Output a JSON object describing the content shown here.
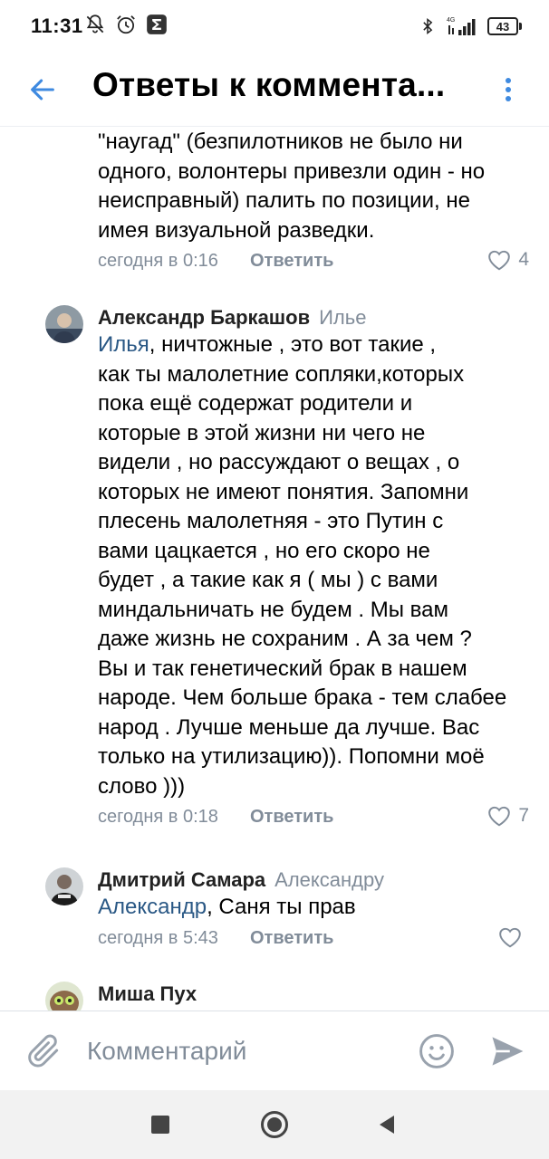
{
  "status_bar": {
    "time": "11:31",
    "icons_left": [
      "no-notifications-icon",
      "alarm-icon",
      "sigma-app-icon"
    ],
    "icons_right": [
      "bluetooth-icon",
      "signal-4g-icon"
    ],
    "network": "4G",
    "battery": "43"
  },
  "header": {
    "title": "Ответы к коммента...",
    "back_icon": "arrow-left-icon",
    "more_icon": "more-vertical-icon"
  },
  "colors": {
    "accent": "#3f8ae0",
    "link": "#2a5885",
    "secondary": "#818c99"
  },
  "comments": [
    {
      "author": "",
      "reply_to": "",
      "mention": "",
      "text_lines": [
        "\"наугад\" (безпилотников не было ни",
        "одного, волонтеры привезли один - но",
        "неисправный) палить по позиции, не",
        "имея визуальной разведки."
      ],
      "date": "сегодня в 0:16",
      "reply_label": "Ответить",
      "likes": "4"
    },
    {
      "author": "Александр Баркашов",
      "reply_to": "Илье",
      "mention": "Илья",
      "text_first": ", ничтожные , это вот такие ,",
      "text_lines": [
        "как ты малолетние сопляки,которых",
        "пока ещё содержат родители и",
        "которые в этой жизни ни чего не",
        "видели , но рассуждают о вещах , о",
        "которых не имеют понятия. Запомни",
        "плесень малолетняя - это Путин с",
        "вами цацкается , но его скоро не",
        "будет , а такие как я ( мы ) с вами",
        "миндальничать не будем . Мы вам",
        "даже жизнь не сохраним . А за чем ?",
        "Вы и так генетический брак в нашем",
        "народе. Чем больше брака - тем слабее",
        "народ . Лучше меньше да лучше. Вас",
        "только на утилизацию)). Попомни моё",
        "слово )))"
      ],
      "date": "сегодня в 0:18",
      "reply_label": "Ответить",
      "likes": "7"
    },
    {
      "author": "Дмитрий Самара",
      "reply_to": "Александру",
      "mention": "Александр",
      "text_first": ", Саня ты прав",
      "date": "сегодня в 5:43",
      "reply_label": "Ответить",
      "likes": ""
    },
    {
      "author": "Миша Пух"
    }
  ],
  "composer": {
    "placeholder": "Комментарий",
    "attach_icon": "paperclip-icon",
    "emoji_icon": "smile-icon",
    "send_icon": "send-icon"
  },
  "nav": {
    "icons": [
      "recents-square-icon",
      "home-circle-icon",
      "back-triangle-icon"
    ]
  }
}
